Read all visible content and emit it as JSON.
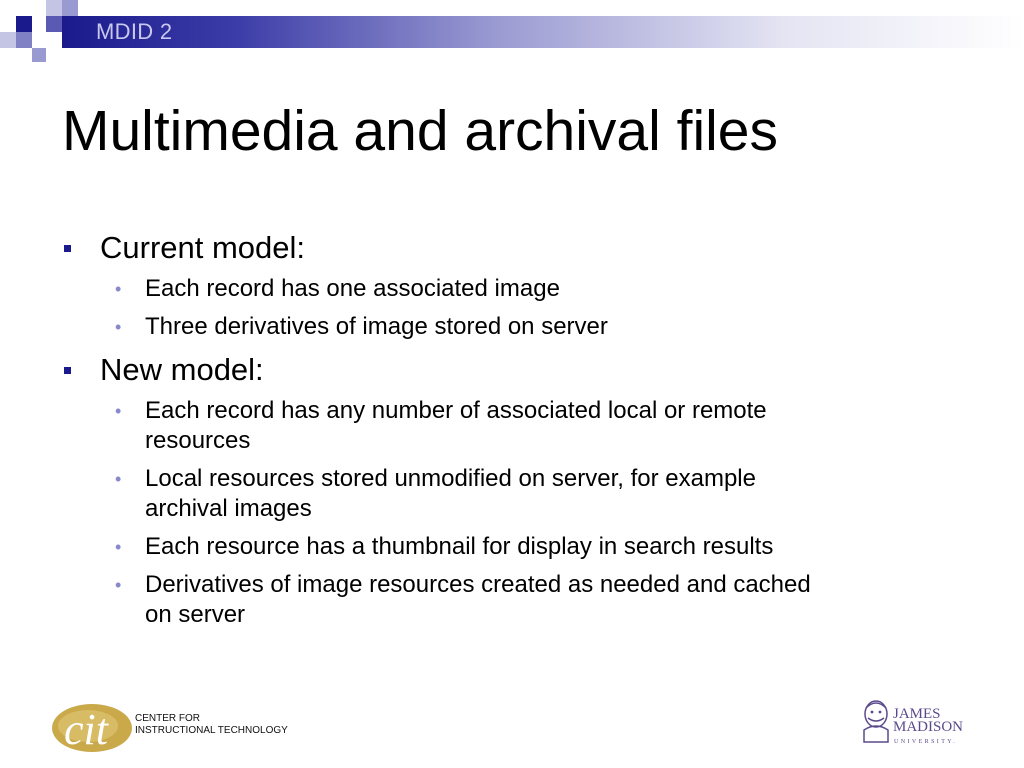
{
  "header": {
    "label": "MDID 2",
    "colors": {
      "dark": "#1a1a8c",
      "light": "#9a9ad2"
    }
  },
  "slide": {
    "title": "Multimedia and archival files",
    "sections": [
      {
        "heading": "Current model:",
        "items": [
          [
            "Each record has one associated image"
          ],
          [
            "Three derivatives of image stored on server"
          ]
        ]
      },
      {
        "heading": "New model:",
        "items": [
          [
            "Each record has any number of associated local or remote",
            "resources"
          ],
          [
            "Local resources stored unmodified on server, for example",
            "archival images"
          ],
          [
            "Each resource has a thumbnail for display in search results"
          ],
          [
            "Derivatives of image resources created as needed and cached",
            "on server"
          ]
        ]
      }
    ]
  },
  "footer": {
    "cit": {
      "logo_text": "cit",
      "line1": "CENTER FOR",
      "line2": "INSTRUCTIONAL TECHNOLOGY"
    },
    "jmu": {
      "line1": "JAMES",
      "line2": "MADISON",
      "line3": "UNIVERSITY."
    }
  }
}
